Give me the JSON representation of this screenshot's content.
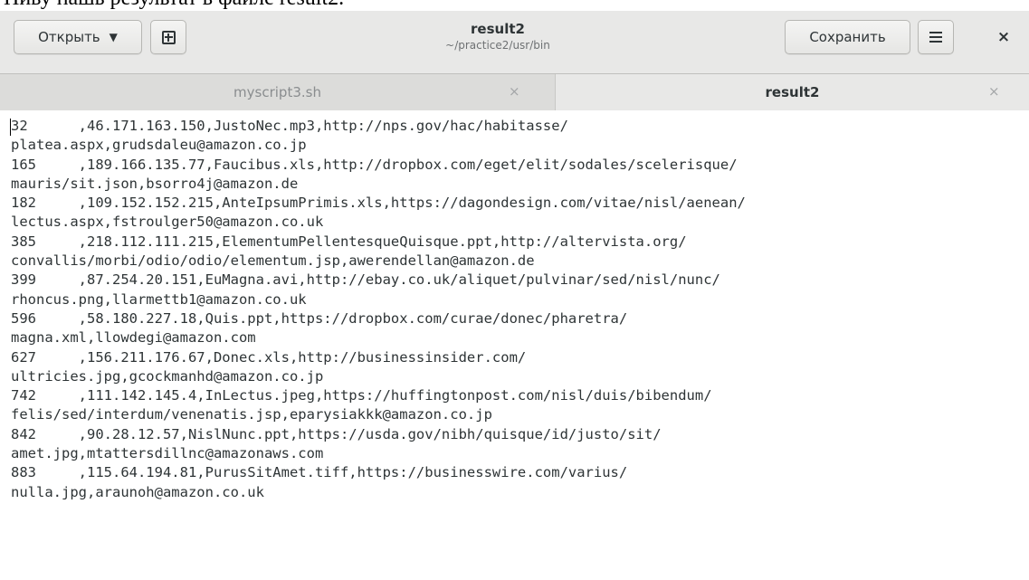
{
  "window": {
    "title": "result2",
    "subtitle": "~/practice2/usr/bin"
  },
  "toolbar": {
    "open_label": "Открыть",
    "save_label": "Сохранить"
  },
  "tabs": [
    {
      "label": "myscript3.sh",
      "close": "×"
    },
    {
      "label": "result2",
      "close": "×"
    }
  ],
  "icons": {
    "open_caret": "chevron-down-icon",
    "new_document": "new-document-icon",
    "menu": "hamburger-menu-icon",
    "close_glyph": "×"
  },
  "editor": {
    "lines": [
      "32      ,46.171.163.150,JustoNec.mp3,http://nps.gov/hac/habitasse/",
      "platea.aspx,grudsdaleu@amazon.co.jp",
      "165     ,189.166.135.77,Faucibus.xls,http://dropbox.com/eget/elit/sodales/scelerisque/",
      "mauris/sit.json,bsorro4j@amazon.de",
      "182     ,109.152.152.215,AnteIpsumPrimis.xls,https://dagondesign.com/vitae/nisl/aenean/",
      "lectus.aspx,fstroulger50@amazon.co.uk",
      "385     ,218.112.111.215,ElementumPellentesqueQuisque.ppt,http://altervista.org/",
      "convallis/morbi/odio/odio/elementum.jsp,awerendellan@amazon.de",
      "399     ,87.254.20.151,EuMagna.avi,http://ebay.co.uk/aliquet/pulvinar/sed/nisl/nunc/",
      "rhoncus.png,llarmettb1@amazon.co.uk",
      "596     ,58.180.227.18,Quis.ppt,https://dropbox.com/curae/donec/pharetra/",
      "magna.xml,llowdegi@amazon.com",
      "627     ,156.211.176.67,Donec.xls,http://businessinsider.com/",
      "ultricies.jpg,gcockmanhd@amazon.co.jp",
      "742     ,111.142.145.4,InLectus.jpeg,https://huffingtonpost.com/nisl/duis/bibendum/",
      "felis/sed/interdum/venenatis.jsp,eparysiakkk@amazon.co.jp",
      "842     ,90.28.12.57,NislNunc.ppt,https://usda.gov/nibh/quisque/id/justo/sit/",
      "amet.jpg,mtattersdillnc@amazonaws.com",
      "883     ,115.64.194.81,PurusSitAmet.tiff,https://businesswire.com/varius/",
      "nulla.jpg,araunoh@amazon.co.uk"
    ]
  },
  "colors": {
    "headerbar": "#e8e8e7",
    "tabbar": "#dcdcda",
    "text": "#2e3436"
  }
}
